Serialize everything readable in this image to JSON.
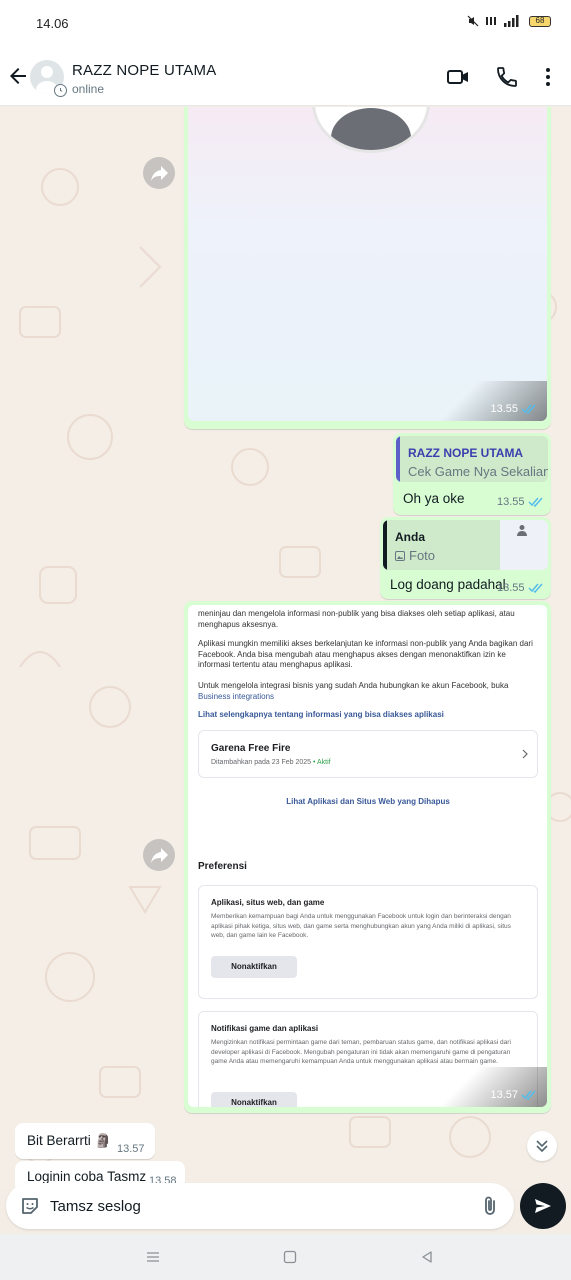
{
  "status_bar": {
    "time": "14.06",
    "battery": "68"
  },
  "header": {
    "contact_name": "RAZZ NOPE UTAMA",
    "status": "online"
  },
  "messages": {
    "image1": {
      "time": "13.55"
    },
    "reply1": {
      "quote_name": "RAZZ NOPE UTAMA",
      "quote_text": "Cek Game Nya Sekalian",
      "text": "Oh ya oke",
      "time": "13.55"
    },
    "reply2": {
      "quote_name": "Anda",
      "quote_text": "Foto",
      "text": "Log doang padahal",
      "time": "13.55"
    },
    "screenshot": {
      "time": "13.57",
      "para1": "meninjau dan mengelola informasi non-publik yang bisa diakses oleh setiap aplikasi, atau menghapus aksesnya.",
      "para2": "Aplikasi mungkin memiliki akses berkelanjutan ke informasi non-publik yang Anda bagikan dari Facebook. Anda bisa mengubah atau menghapus akses dengan menonaktifkan izin ke informasi tertentu atau menghapus aplikasi.",
      "para3_prefix": "Untuk mengelola integrasi bisnis yang sudah Anda hubungkan ke akun Facebook, buka",
      "para3_link": "Business integrations",
      "see_more": "Lihat selengkapnya tentang informasi yang bisa diakses aplikasi",
      "app_name": "Garena Free Fire",
      "app_added": "Ditambahkan pada 23 Feb 2025",
      "app_status": "• Aktif",
      "removed_link": "Lihat Aplikasi dan Situs Web yang Dihapus",
      "preferences": "Preferensi",
      "pref1_title": "Aplikasi, situs web, dan game",
      "pref1_desc": "Memberikan kemampuan bagi Anda untuk menggunakan Facebook untuk login dan berinteraksi dengan aplikasi pihak ketiga, situs web, dan game serta menghubungkan akun yang Anda miliki di aplikasi, situs web, dan game lain ke Facebook.",
      "pref1_button": "Nonaktifkan",
      "pref2_title": "Notifikasi game dan aplikasi",
      "pref2_desc": "Mengizinkan notifikasi permintaan game dari teman, pembaruan status game, dan notifikasi aplikasi dari developer aplikasi di Facebook. Mengubah pengaturan ini tidak akan memengaruhi game di pengaturan game Anda atau memengaruhi kemampuan Anda untuk menggunakan aplikasi atau bermain game.",
      "pref2_button": "Nonaktifkan"
    },
    "incoming1": {
      "text": "Bit Berarrti 🗿",
      "time": "13.57"
    },
    "incoming2": {
      "text": "Loginin coba Tasmz",
      "time": "13.58"
    }
  },
  "composer": {
    "text": "Tamsz seslog"
  },
  "colors": {
    "outgoing_bubble": "#d9fdd3",
    "read_tick": "#53bdeb",
    "quote_bar_contact": "#5c5fc8",
    "quote_bar_self": "#111b21"
  },
  "icons": [
    "back-arrow-icon",
    "disappearing-timer-icon",
    "video-call-icon",
    "voice-call-icon",
    "more-options-icon",
    "forward-icon",
    "double-check-icon",
    "photo-icon",
    "sticker-icon",
    "attach-icon",
    "send-icon",
    "chevron-double-down-icon"
  ]
}
